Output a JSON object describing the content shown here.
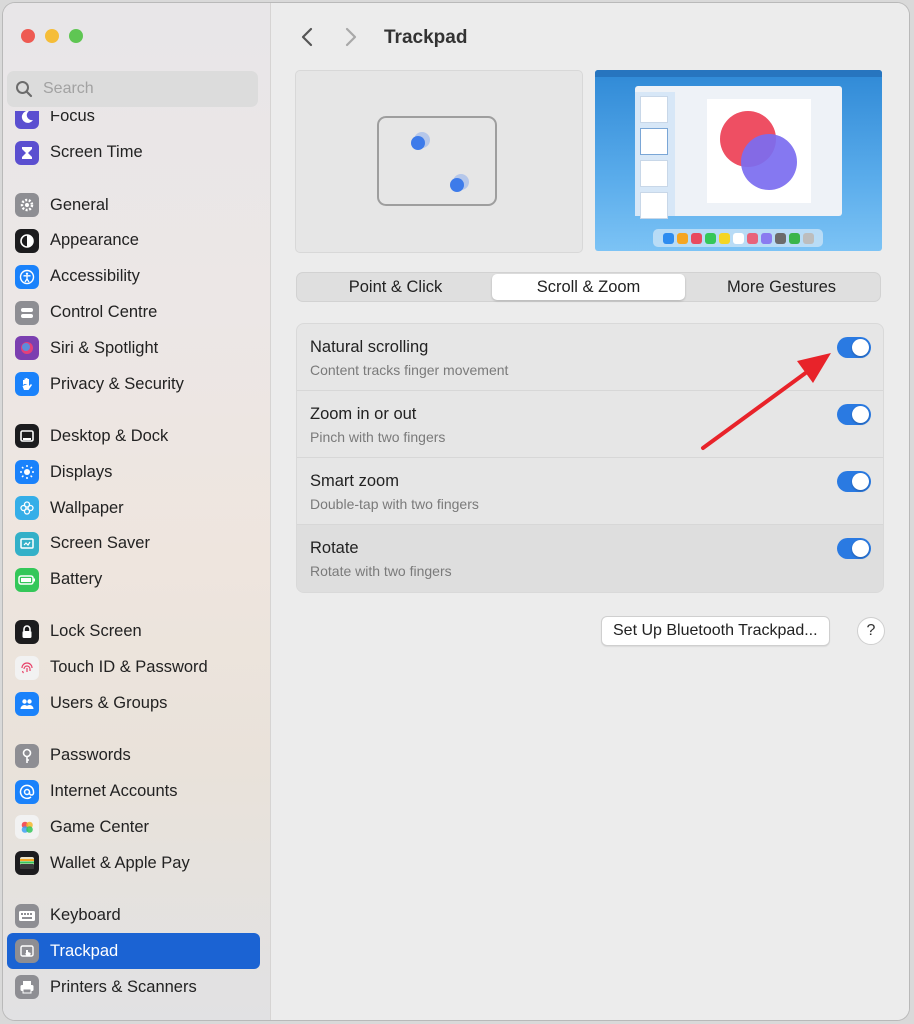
{
  "window": {
    "controls": [
      "close-button",
      "minimize-button",
      "maximize-button"
    ]
  },
  "sidebar": {
    "search_placeholder": "Search",
    "groups": [
      [
        {
          "label": "Focus",
          "icon": "moon-icon",
          "color": "#5b4fd0"
        },
        {
          "label": "Screen Time",
          "icon": "hourglass-icon",
          "color": "#5b4fd0"
        }
      ],
      [
        {
          "label": "General",
          "icon": "gear-icon",
          "color": "#8e8e93"
        },
        {
          "label": "Appearance",
          "icon": "appearance-icon",
          "color": "#1c1c1e"
        },
        {
          "label": "Accessibility",
          "icon": "accessibility-icon",
          "color": "#1a82fb"
        },
        {
          "label": "Control Centre",
          "icon": "control-centre-icon",
          "color": "#8e8e93"
        },
        {
          "label": "Siri & Spotlight",
          "icon": "siri-icon",
          "color": "#7b3fb0"
        },
        {
          "label": "Privacy & Security",
          "icon": "hand-icon",
          "color": "#1a82fb"
        }
      ],
      [
        {
          "label": "Desktop & Dock",
          "icon": "dock-icon",
          "color": "#1c1c1e"
        },
        {
          "label": "Displays",
          "icon": "sun-icon",
          "color": "#1a82fb"
        },
        {
          "label": "Wallpaper",
          "icon": "flower-icon",
          "color": "#35aee8"
        },
        {
          "label": "Screen Saver",
          "icon": "screen-saver-icon",
          "color": "#33b0c8"
        },
        {
          "label": "Battery",
          "icon": "battery-icon",
          "color": "#34c759"
        }
      ],
      [
        {
          "label": "Lock Screen",
          "icon": "lock-icon",
          "color": "#1c1c1e"
        },
        {
          "label": "Touch ID & Password",
          "icon": "fingerprint-icon",
          "color": "#f2f2f2"
        },
        {
          "label": "Users & Groups",
          "icon": "users-icon",
          "color": "#1a82fb"
        }
      ],
      [
        {
          "label": "Passwords",
          "icon": "key-icon",
          "color": "#8e8e93"
        },
        {
          "label": "Internet Accounts",
          "icon": "at-icon",
          "color": "#1a82fb"
        },
        {
          "label": "Game Center",
          "icon": "game-center-icon",
          "color": "#f2f2f2"
        },
        {
          "label": "Wallet & Apple Pay",
          "icon": "wallet-icon",
          "color": "#1c1c1e"
        }
      ],
      [
        {
          "label": "Keyboard",
          "icon": "keyboard-icon",
          "color": "#8e8e93"
        },
        {
          "label": "Trackpad",
          "icon": "trackpad-icon",
          "color": "#8e8e93",
          "active": true
        },
        {
          "label": "Printers & Scanners",
          "icon": "printer-icon",
          "color": "#8e8e93"
        }
      ]
    ]
  },
  "toolbar": {
    "title": "Trackpad"
  },
  "tabs": [
    {
      "label": "Point & Click",
      "active": false
    },
    {
      "label": "Scroll & Zoom",
      "active": true
    },
    {
      "label": "More Gestures",
      "active": false
    }
  ],
  "settings": [
    {
      "title": "Natural scrolling",
      "subtitle": "Content tracks finger movement",
      "enabled": true
    },
    {
      "title": "Zoom in or out",
      "subtitle": "Pinch with two fingers",
      "enabled": true
    },
    {
      "title": "Smart zoom",
      "subtitle": "Double-tap with two fingers",
      "enabled": true
    },
    {
      "title": "Rotate",
      "subtitle": "Rotate with two fingers",
      "enabled": true
    }
  ],
  "buttons": {
    "bluetooth": "Set Up Bluetooth Trackpad...",
    "help": "?"
  },
  "accent_color": "#1b63d3",
  "annotation_color": "#e8232a"
}
